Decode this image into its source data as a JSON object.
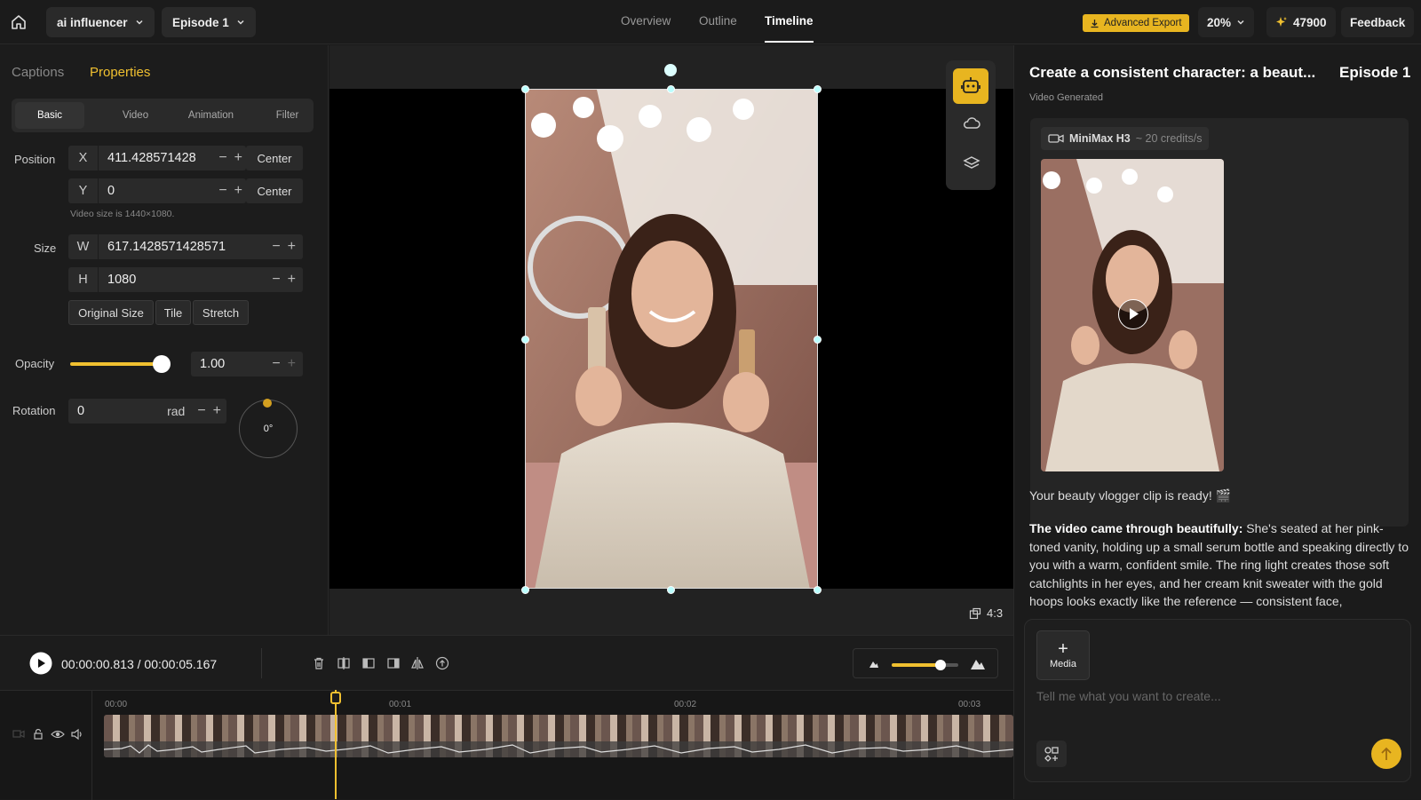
{
  "topbar": {
    "project": "ai influencer",
    "episode": "Episode 1",
    "tabs": [
      "Overview",
      "Outline",
      "Timeline"
    ],
    "active_tab": "Timeline",
    "export_label": "Advanced Export",
    "zoom": "20%",
    "credits": "47900",
    "feedback": "Feedback"
  },
  "left": {
    "tabs": [
      "Captions",
      "Properties"
    ],
    "active_tab": "Properties",
    "subtabs": [
      "Basic",
      "Video",
      "Animation",
      "Filter"
    ],
    "position_label": "Position",
    "x_key": "X",
    "x": "411.428571428",
    "y_key": "Y",
    "y": "0",
    "center": "Center",
    "video_size_note": "Video size is 1440×1080.",
    "size_label": "Size",
    "w_key": "W",
    "w": "617.1428571428571",
    "h_key": "H",
    "h": "1080",
    "size_buttons": [
      "Original Size",
      "Tile",
      "Stretch"
    ],
    "opacity_label": "Opacity",
    "opacity": "1.00",
    "opacity_level": 1.0,
    "rotation_label": "Rotation",
    "rotation": "0",
    "rotation_unit": "rad",
    "rotation_deg": "0°"
  },
  "canvas": {
    "aspect_ratio": "4:3"
  },
  "right": {
    "title": "Create a consistent character: a beaut...",
    "episode": "Episode 1",
    "status": "Video Generated",
    "model": "MiniMax H3",
    "cost": "~ 20 credits/s",
    "msg1": "Your beauty vlogger clip is ready! 🎬",
    "msg2_bold": "The video came through beautifully:",
    "msg2": " She's seated at her pink-toned vanity, holding up a small serum bottle and speaking directly to you with a warm, confident smile. The ring light creates those soft catchlights in her eyes, and her cream knit sweater with the gold hoops looks exactly like the reference — consistent face,",
    "media_label": "Media",
    "prompt_placeholder": "Tell me what you want to create..."
  },
  "player": {
    "current": "00:00:00.813",
    "total": "00:00:05.167",
    "separator": "/"
  },
  "timeline": {
    "marks": [
      "00:00",
      "00:01",
      "00:02",
      "00:03"
    ]
  },
  "colors": {
    "accent": "#f0c030",
    "export_bg": "#e8b520"
  }
}
